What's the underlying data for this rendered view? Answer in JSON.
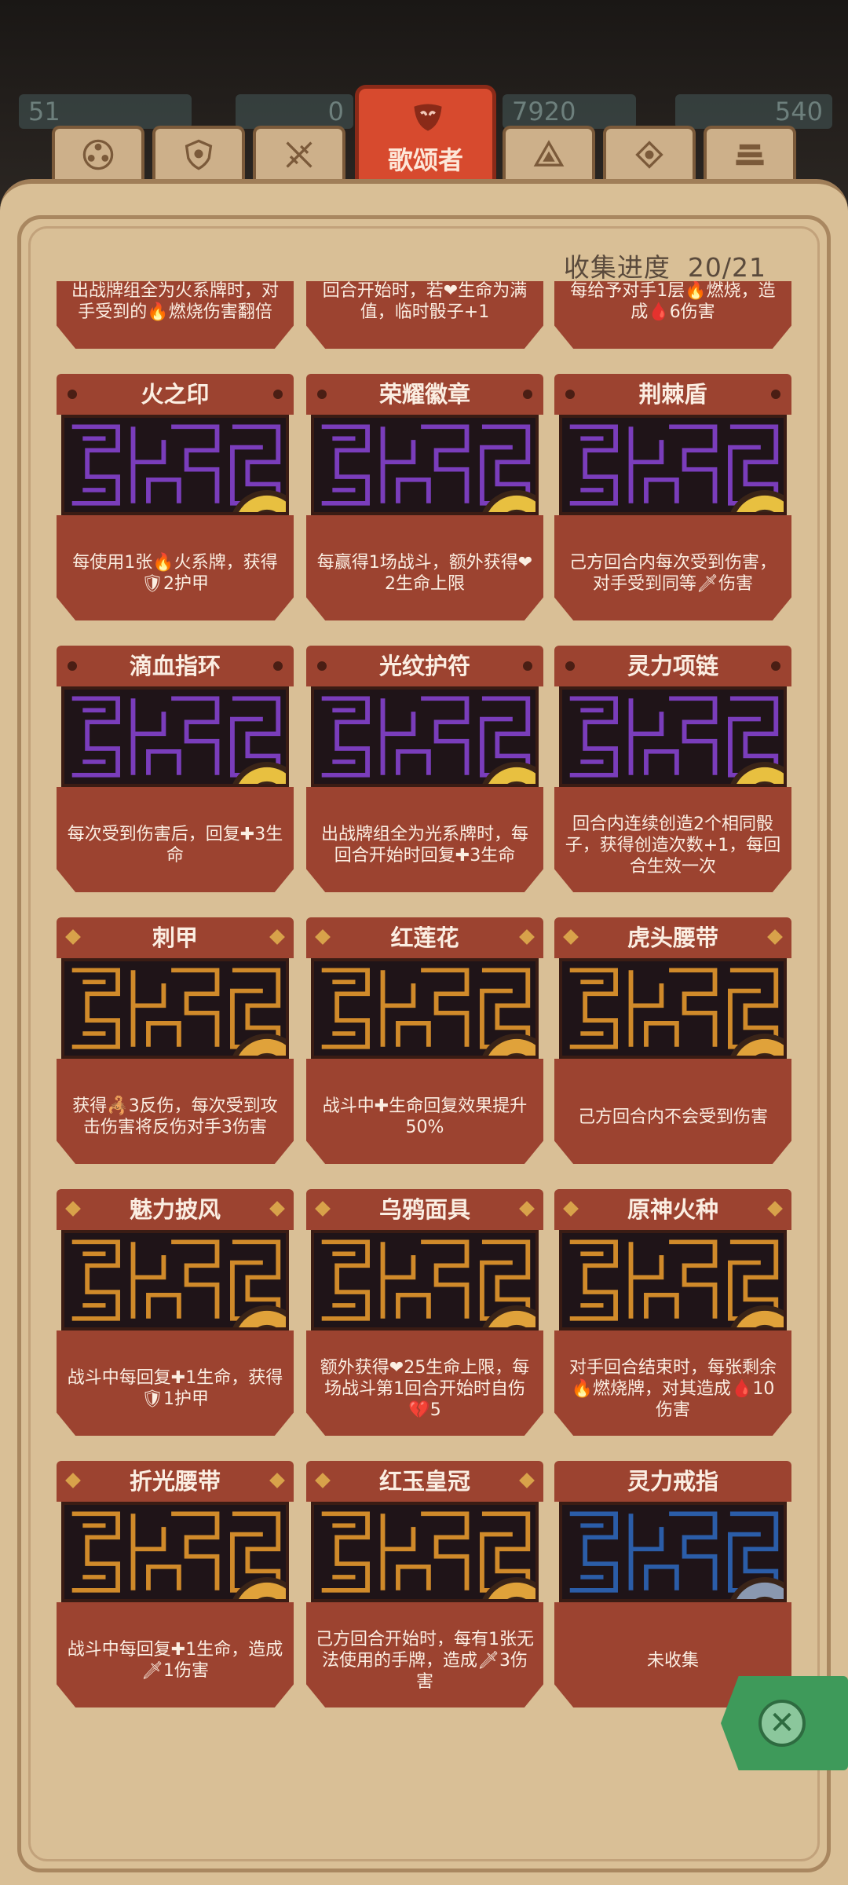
{
  "resources": [
    "51",
    "0",
    "7920",
    "540"
  ],
  "tabs": {
    "active_label": "歌颂者",
    "icons": [
      "wheel-icon",
      "shield-icon",
      "swords-icon",
      "mask-icon",
      "triangle-icon",
      "eye-icon",
      "stack-icon"
    ]
  },
  "header": {
    "progress_label": "收集进度",
    "progress_value": "20/21"
  },
  "cards": [
    {
      "title": "",
      "desc": "出战牌组全为火系牌时，对手受到的🔥燃烧伤害翻倍",
      "maze": "#2b5da8",
      "rarity": "dot",
      "icon": "coin-icon"
    },
    {
      "title": "",
      "desc": "回合开始时，若❤生命为满值，临时骰子+1",
      "maze": "#7a3dbb",
      "rarity": "dot",
      "icon": "clover-icon"
    },
    {
      "title": "",
      "desc": "每给予对手1层🔥燃烧，造成🩸6伤害",
      "maze": "#7a3dbb",
      "rarity": "dot",
      "icon": "book-icon"
    },
    {
      "title": "火之印",
      "desc": "每使用1张🔥火系牌，获得🛡2护甲",
      "maze": "#7a3dbb",
      "rarity": "dot",
      "icon": "flame-icon"
    },
    {
      "title": "荣耀徽章",
      "desc": "每赢得1场战斗，额外获得❤2生命上限",
      "maze": "#7a3dbb",
      "rarity": "dot",
      "icon": "sun-badge-icon"
    },
    {
      "title": "荆棘盾",
      "desc": "己方回合内每次受到伤害，对手受到同等🗡伤害",
      "maze": "#7a3dbb",
      "rarity": "dot",
      "icon": "thorn-shield-icon"
    },
    {
      "title": "滴血指环",
      "desc": "每次受到伤害后，回复✚3生命",
      "maze": "#7a3dbb",
      "rarity": "dot",
      "icon": "blood-ring-icon"
    },
    {
      "title": "光纹护符",
      "desc": "出战牌组全为光系牌时，每回合开始时回复✚3生命",
      "maze": "#7a3dbb",
      "rarity": "dot",
      "icon": "amulet-icon"
    },
    {
      "title": "灵力项链",
      "desc": "回合内连续创造2个相同骰子，获得创造次数+1，每回合生效一次",
      "maze": "#7a3dbb",
      "rarity": "dot",
      "icon": "necklace-icon"
    },
    {
      "title": "刺甲",
      "desc": "获得🦂3反伤，每次受到攻击伤害将反伤对手3伤害",
      "maze": "#d08a2a",
      "rarity": "dia",
      "icon": "spike-armor-icon"
    },
    {
      "title": "红莲花",
      "desc": "战斗中✚生命回复效果提升50%",
      "maze": "#d08a2a",
      "rarity": "dia",
      "icon": "lotus-icon"
    },
    {
      "title": "虎头腰带",
      "desc": "己方回合内不会受到伤害",
      "maze": "#d08a2a",
      "rarity": "dia",
      "icon": "tiger-belt-icon"
    },
    {
      "title": "魅力披风",
      "desc": "战斗中每回复✚1生命，获得🛡1护甲",
      "maze": "#d08a2a",
      "rarity": "dia",
      "icon": "cloak-icon"
    },
    {
      "title": "乌鸦面具",
      "desc": "额外获得❤25生命上限，每场战斗第1回合开始时自伤💔5",
      "maze": "#d08a2a",
      "rarity": "dia",
      "icon": "crow-mask-icon"
    },
    {
      "title": "原神火种",
      "desc": "对手回合结束时，每张剩余🔥燃烧牌，对其造成🩸10伤害",
      "maze": "#d08a2a",
      "rarity": "dia",
      "icon": "fire-spirit-icon"
    },
    {
      "title": "折光腰带",
      "desc": "战斗中每回复✚1生命，造成🗡1伤害",
      "maze": "#d08a2a",
      "rarity": "dia",
      "icon": "refract-belt-icon"
    },
    {
      "title": "红玉皇冠",
      "desc": "己方回合开始时，每有1张无法使用的手牌，造成🗡3伤害",
      "maze": "#d08a2a",
      "rarity": "dia",
      "icon": "crown-icon"
    },
    {
      "title": "灵力戒指",
      "desc": "未收集",
      "maze": "#2b5da8",
      "rarity": "none",
      "icon": "spirit-ring-icon"
    }
  ],
  "close": {
    "label": "✕"
  }
}
